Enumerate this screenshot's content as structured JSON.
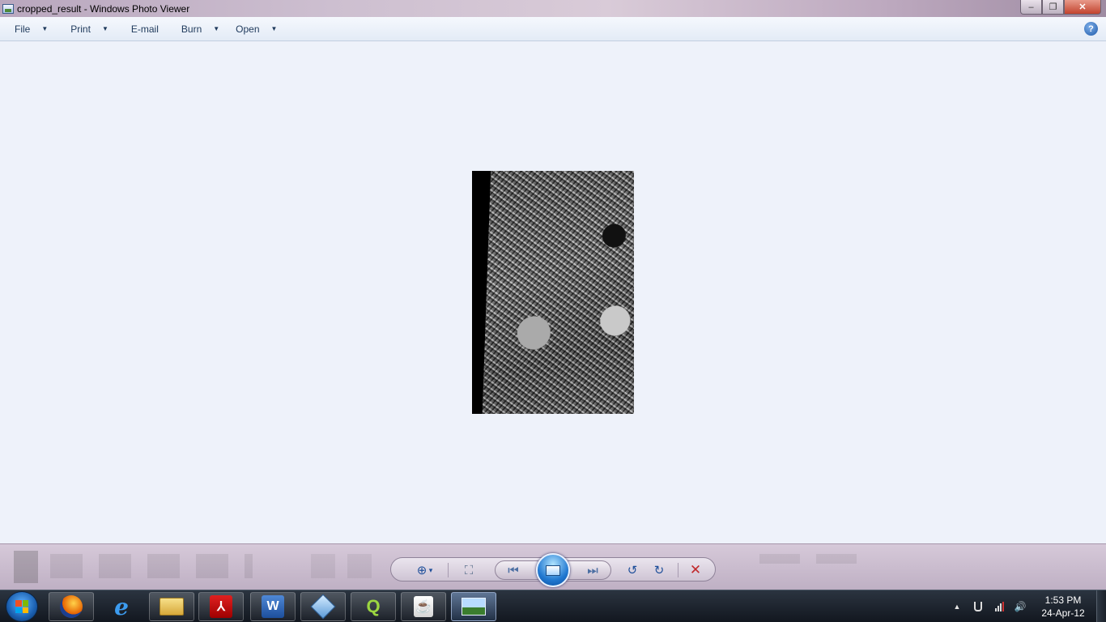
{
  "window": {
    "title": "cropped_result - Windows Photo Viewer",
    "controls": {
      "minimize": "‒",
      "restore": "❐",
      "close": "✕"
    }
  },
  "menu": {
    "file": "File",
    "print": "Print",
    "email": "E-mail",
    "burn": "Burn",
    "open": "Open",
    "help_glyph": "?"
  },
  "photo": {
    "description_icon": "aerial-photo"
  },
  "controls": {
    "zoom_glyph": "⊕",
    "zoom_caret": "▾",
    "actual_size_glyph": "⛶",
    "previous_glyph": "⏮",
    "next_glyph": "⏭",
    "rotate_ccw_glyph": "↺",
    "rotate_cw_glyph": "↻",
    "delete_glyph": "✕"
  },
  "taskbar": {
    "clock_time": "1:53 PM",
    "clock_date": "24-Apr-12",
    "apps": [
      "firefox",
      "internet-explorer",
      "windows-explorer",
      "adobe-reader",
      "microsoft-word",
      "virtualbox",
      "qgis",
      "java",
      "windows-photo-viewer"
    ],
    "tray_arrow": "▲",
    "volume_glyph": "🔊"
  },
  "colors": {
    "accent_blue": "#1f4f9a",
    "delete_red": "#c0282b",
    "taskbar": "#1b222b"
  }
}
